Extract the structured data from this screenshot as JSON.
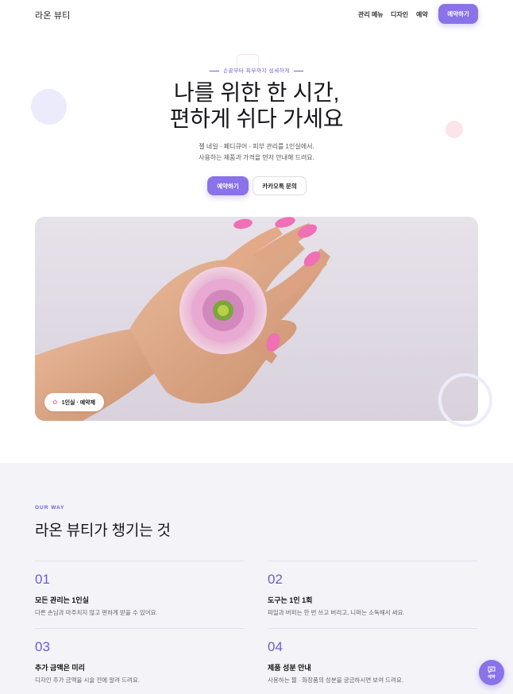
{
  "header": {
    "logo": "라온 뷰티",
    "nav": [
      "관리 메뉴",
      "디자인",
      "예약"
    ],
    "book_button": "예약하기"
  },
  "hero": {
    "eyebrow": "손끝부터 피부까지 섬세하게",
    "title_line1": "나를 위한 한 시간,",
    "title_line2": "편하게 쉬다 가세요",
    "subtitle_line1": "젤 네일 · 페디큐어 · 피부 관리를 1인실에서.",
    "subtitle_line2": "사용하는 제품과 가격을 먼저 안내해 드려요.",
    "primary_button": "예약하기",
    "secondary_button": "카카오톡 문의",
    "image_badge": "1인실 · 예약제",
    "image_alt_icon": "flower-icon"
  },
  "features": {
    "eyebrow": "OUR WAY",
    "title": "라온 뷰티가 챙기는 것",
    "items": [
      {
        "num": "01",
        "title": "모든 관리는 1인실",
        "desc": "다른 손님과 마주치지 않고 편하게 받을 수 있어요."
      },
      {
        "num": "02",
        "title": "도구는 1인 1회",
        "desc": "파일과 버퍼는 한 번 쓰고 버리고, 니퍼는 소독해서 써요."
      },
      {
        "num": "03",
        "title": "추가 금액은 미리",
        "desc": "디자인 추가 금액을 시술 전에 알려 드려요."
      },
      {
        "num": "04",
        "title": "제품 성분 안내",
        "desc": "사용하는 젤 · 화장품의 성분을 궁금하시면 보여 드려요."
      }
    ]
  },
  "fab": {
    "label": "예약",
    "icon": "chat-icon"
  },
  "colors": {
    "accent": "#8a72e8",
    "accent_text": "#6a5bd6",
    "section_bg": "#f4f3f8"
  }
}
